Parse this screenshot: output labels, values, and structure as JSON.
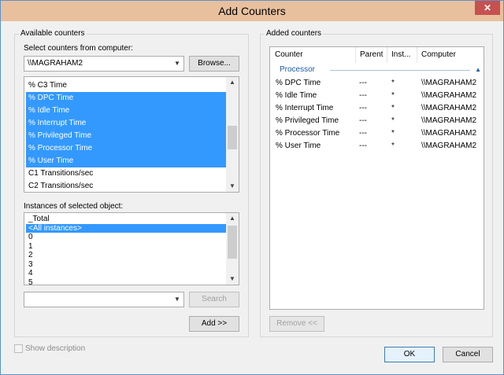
{
  "window": {
    "title": "Add Counters",
    "close_glyph": "✕"
  },
  "available": {
    "group_label": "Available counters",
    "computer_label": "Select counters from computer:",
    "computer_value": "\\\\MAGRAHAM2",
    "browse_label": "Browse...",
    "counters": [
      {
        "label": "% C3 Time",
        "selected": false
      },
      {
        "label": "% DPC Time",
        "selected": true
      },
      {
        "label": "% Idle Time",
        "selected": true
      },
      {
        "label": "% Interrupt Time",
        "selected": true
      },
      {
        "label": "% Privileged Time",
        "selected": true
      },
      {
        "label": "% Processor Time",
        "selected": true
      },
      {
        "label": "% User Time",
        "selected": true
      },
      {
        "label": "C1 Transitions/sec",
        "selected": false
      },
      {
        "label": "C2 Transitions/sec",
        "selected": false
      }
    ],
    "instances_label": "Instances of selected object:",
    "instances": [
      {
        "label": "_Total",
        "selected": false
      },
      {
        "label": "<All instances>",
        "selected": true
      },
      {
        "label": "0",
        "selected": false
      },
      {
        "label": "1",
        "selected": false
      },
      {
        "label": "2",
        "selected": false
      },
      {
        "label": "3",
        "selected": false
      },
      {
        "label": "4",
        "selected": false
      },
      {
        "label": "5",
        "selected": false
      }
    ],
    "search_value": "",
    "search_label": "Search",
    "add_label": "Add >>"
  },
  "added": {
    "group_label": "Added counters",
    "columns": [
      "Counter",
      "Parent",
      "Inst...",
      "Computer"
    ],
    "group_name": "Processor",
    "rows": [
      {
        "counter": "% DPC Time",
        "parent": "---",
        "instance": "*",
        "computer": "\\\\MAGRAHAM2"
      },
      {
        "counter": "% Idle Time",
        "parent": "---",
        "instance": "*",
        "computer": "\\\\MAGRAHAM2"
      },
      {
        "counter": "% Interrupt Time",
        "parent": "---",
        "instance": "*",
        "computer": "\\\\MAGRAHAM2"
      },
      {
        "counter": "% Privileged Time",
        "parent": "---",
        "instance": "*",
        "computer": "\\\\MAGRAHAM2"
      },
      {
        "counter": "% Processor Time",
        "parent": "---",
        "instance": "*",
        "computer": "\\\\MAGRAHAM2"
      },
      {
        "counter": "% User Time",
        "parent": "---",
        "instance": "*",
        "computer": "\\\\MAGRAHAM2"
      }
    ],
    "remove_label": "Remove <<"
  },
  "footer": {
    "show_description_label": "Show description",
    "ok_label": "OK",
    "cancel_label": "Cancel"
  },
  "colors": {
    "selection": "#3399ff",
    "titlebar": "#e8c09e",
    "close_button": "#c75050",
    "group_header": "#1e5aa8"
  },
  "icons": [
    "close-icon",
    "chevron-down-icon",
    "chevron-up-icon",
    "checkbox-icon"
  ]
}
